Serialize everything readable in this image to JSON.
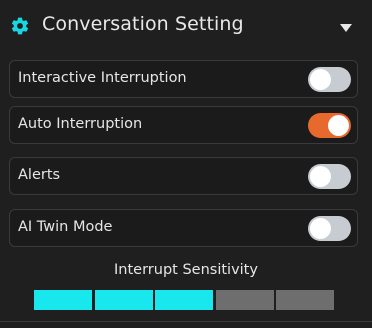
{
  "header": {
    "title": "Conversation Setting",
    "icon": "gear-icon",
    "collapse_icon": "caret-down-icon"
  },
  "toggles": [
    {
      "label": "Interactive Interruption",
      "on": false
    },
    {
      "label": "Auto Interruption",
      "on": true
    },
    {
      "label": "Alerts",
      "on": false
    },
    {
      "label": "AI Twin Mode",
      "on": false
    }
  ],
  "sensitivity": {
    "label": "Interrupt Sensitivity",
    "level": 3,
    "max": 5
  },
  "colors": {
    "accent_on": "#e8692d",
    "toggle_off": "#c7cbd2",
    "meter_active": "#19e7ee",
    "meter_inactive": "#6e6e6e",
    "gear": "#19d6e0"
  }
}
